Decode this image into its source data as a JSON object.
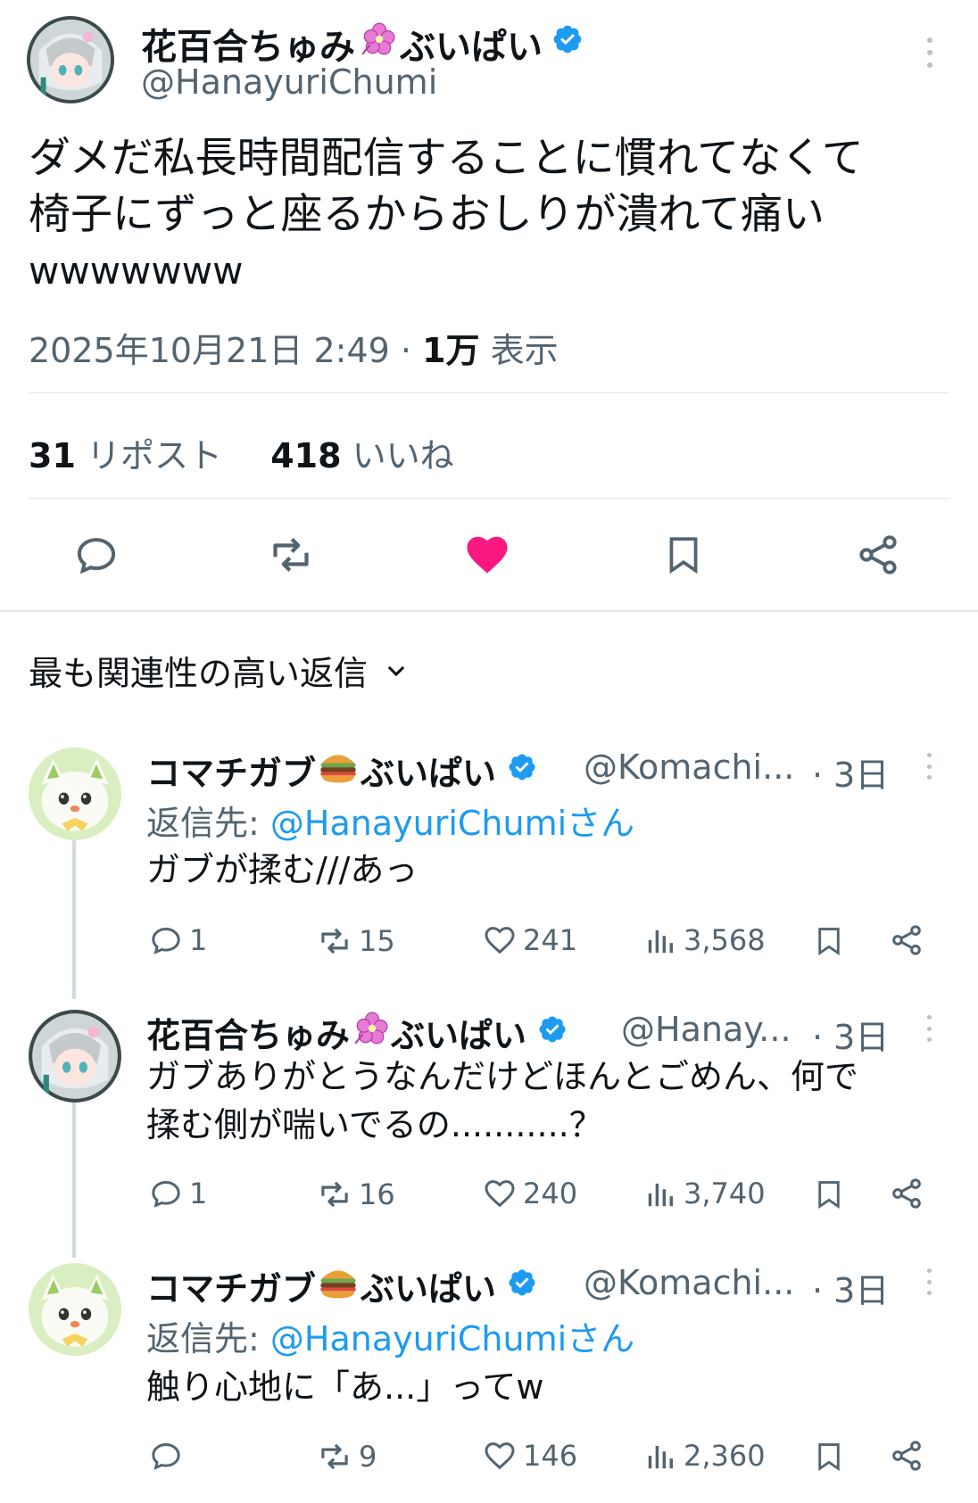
{
  "main_tweet": {
    "display_name": "花百合ちゅみ",
    "display_name_suffix": "ぶいぱい",
    "handle": "@HanayuriChumi",
    "text_line1": "ダメだ私長時間配信することに慣れてなくて",
    "text_line2": "椅子にずっと座るからおしりが潰れて痛い",
    "text_line3": "wwwwwww",
    "datetime": "2025年10月21日 2:49",
    "views_count": "1万",
    "views_label": "表示",
    "reposts_count": "31",
    "reposts_label": "リポスト",
    "likes_count": "418",
    "likes_label": "いいね",
    "liked": true
  },
  "replies_header": "最も関連性の高い返信",
  "replies": [
    {
      "display_name": "コマチガブ",
      "display_name_suffix": "ぶいぱい",
      "handle": "@Komachi...",
      "time": "· 3日",
      "reply_to_label": "返信先: ",
      "reply_to_handle": "@HanayuriChumiさん",
      "text": "ガブが揉む///あっ",
      "replies": "1",
      "reposts": "15",
      "likes": "241",
      "views": "3,568"
    },
    {
      "display_name": "花百合ちゅみ",
      "display_name_suffix": "ぶいぱい",
      "handle": "@Hanay...",
      "time": "· 3日",
      "text_line1": "ガブありがとうなんだけどほんとごめん、何で",
      "text_line2": "揉む側が喘いでるの...........？",
      "replies": "1",
      "reposts": "16",
      "likes": "240",
      "views": "3,740"
    },
    {
      "display_name": "コマチガブ",
      "display_name_suffix": "ぶいぱい",
      "handle": "@Komachi...",
      "time": "· 3日",
      "reply_to_label": "返信先: ",
      "reply_to_handle": "@HanayuriChumiさん",
      "text": "触り心地に「あ...」ってw",
      "reposts": "9",
      "likes": "146",
      "views": "2,360"
    }
  ],
  "colors": {
    "accent_blue": "#1d9bf0",
    "like_pink": "#f91880",
    "text_primary": "#0f1419",
    "text_secondary": "#536471"
  }
}
